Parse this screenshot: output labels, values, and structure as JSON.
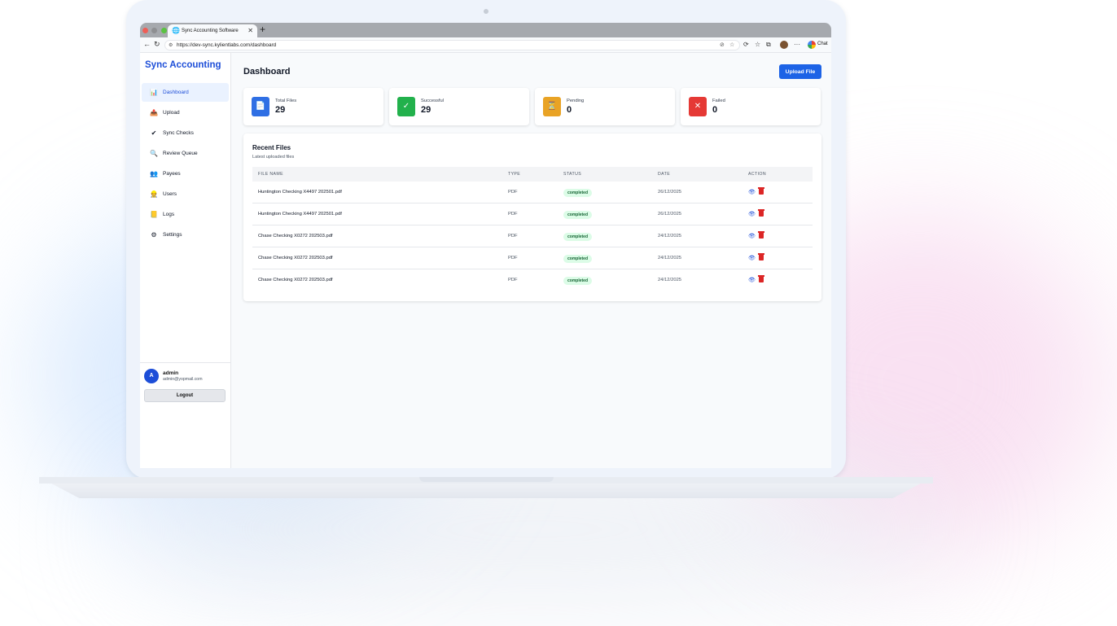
{
  "browser": {
    "tab_title": "Sync Accounting Software",
    "url": "https://dev-sync.kylientlabs.com/dashboard",
    "chat_label": "Chat"
  },
  "sidebar": {
    "brand": "Sync Accounting",
    "items": [
      {
        "label": "Dashboard",
        "icon": "bar-chart-icon",
        "glyph": "📊",
        "active": true
      },
      {
        "label": "Upload",
        "icon": "upload-icon",
        "glyph": "📤",
        "active": false
      },
      {
        "label": "Sync Checks",
        "icon": "check-icon",
        "glyph": "✔",
        "active": false
      },
      {
        "label": "Review Queue",
        "icon": "magnifier-icon",
        "glyph": "🔍",
        "active": false
      },
      {
        "label": "Payees",
        "icon": "people-icon",
        "glyph": "👥",
        "active": false
      },
      {
        "label": "Users",
        "icon": "user-icon",
        "glyph": "👷",
        "active": false
      },
      {
        "label": "Logs",
        "icon": "ledger-icon",
        "glyph": "📒",
        "active": false
      },
      {
        "label": "Settings",
        "icon": "gear-icon",
        "glyph": "⚙",
        "active": false
      }
    ],
    "user": {
      "initial": "A",
      "name": "admin",
      "email": "admin@yopmail.com"
    },
    "logout_label": "Logout"
  },
  "header": {
    "title": "Dashboard",
    "upload_label": "Upload File"
  },
  "stats": [
    {
      "label": "Total Files",
      "value": "29",
      "icon": "document-icon",
      "glyph": "📄",
      "color": "#2f6fe4"
    },
    {
      "label": "Successful",
      "value": "29",
      "icon": "check-box-icon",
      "glyph": "✓",
      "color": "#22b14c"
    },
    {
      "label": "Pending",
      "value": "0",
      "icon": "hourglass-icon",
      "glyph": "⏳",
      "color": "#e9a325"
    },
    {
      "label": "Failed",
      "value": "0",
      "icon": "cross-icon",
      "glyph": "✕",
      "color": "#e53935"
    }
  ],
  "recent": {
    "title": "Recent Files",
    "subtitle": "Latest uploaded files",
    "columns": {
      "name": "FILE NAME",
      "type": "TYPE",
      "status": "STATUS",
      "date": "DATE",
      "action": "ACTION"
    },
    "rows": [
      {
        "name": "Huntington Checking X4497 202501.pdf",
        "type": "PDF",
        "status": "completed",
        "date": "26/12/2025"
      },
      {
        "name": "Huntington Checking X4497 202501.pdf",
        "type": "PDF",
        "status": "completed",
        "date": "26/12/2025"
      },
      {
        "name": "Chase Checking X0272 202503.pdf",
        "type": "PDF",
        "status": "completed",
        "date": "24/12/2025"
      },
      {
        "name": "Chase Checking X0272 202503.pdf",
        "type": "PDF",
        "status": "completed",
        "date": "24/12/2025"
      },
      {
        "name": "Chase Checking X0272 202503.pdf",
        "type": "PDF",
        "status": "completed",
        "date": "24/12/2025"
      }
    ]
  }
}
